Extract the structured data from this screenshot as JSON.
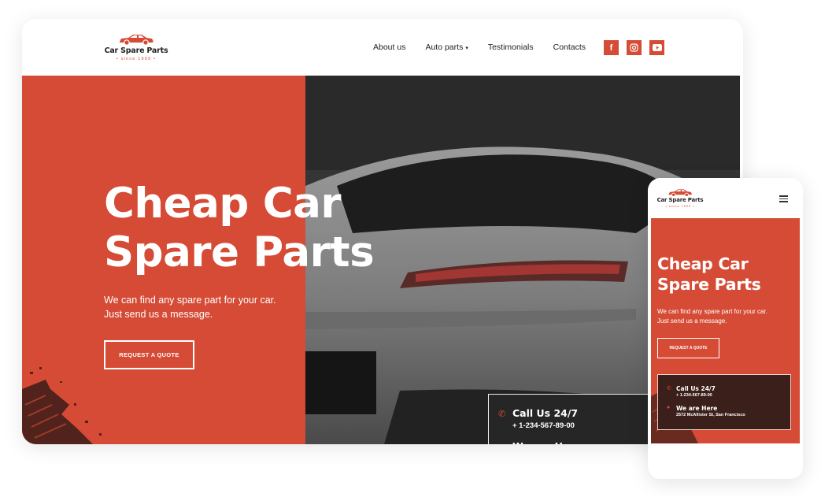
{
  "brand": {
    "name": "Car Spare Parts",
    "since": "• since 1999 •",
    "accent_color": "#d54b35"
  },
  "nav": {
    "items": [
      "About us",
      "Auto parts",
      "Testimonials",
      "Contacts"
    ],
    "dropdown_caret": "▾"
  },
  "social": {
    "icons": [
      "facebook-icon",
      "instagram-icon",
      "youtube-icon"
    ],
    "facebook_glyph": "f"
  },
  "hero": {
    "title_line1": "Cheap Car",
    "title_line2": "Spare Parts",
    "sub_line1": "We can find any spare part for your car.",
    "sub_line2": "Just send us a message.",
    "button": "REQUEST A QUOTE"
  },
  "contact": {
    "call_title": "Call Us 24/7",
    "phone": "+ 1-234-567-89-00",
    "where_title": "We are Here",
    "address": "2572 McAllister St, San Francisco"
  }
}
